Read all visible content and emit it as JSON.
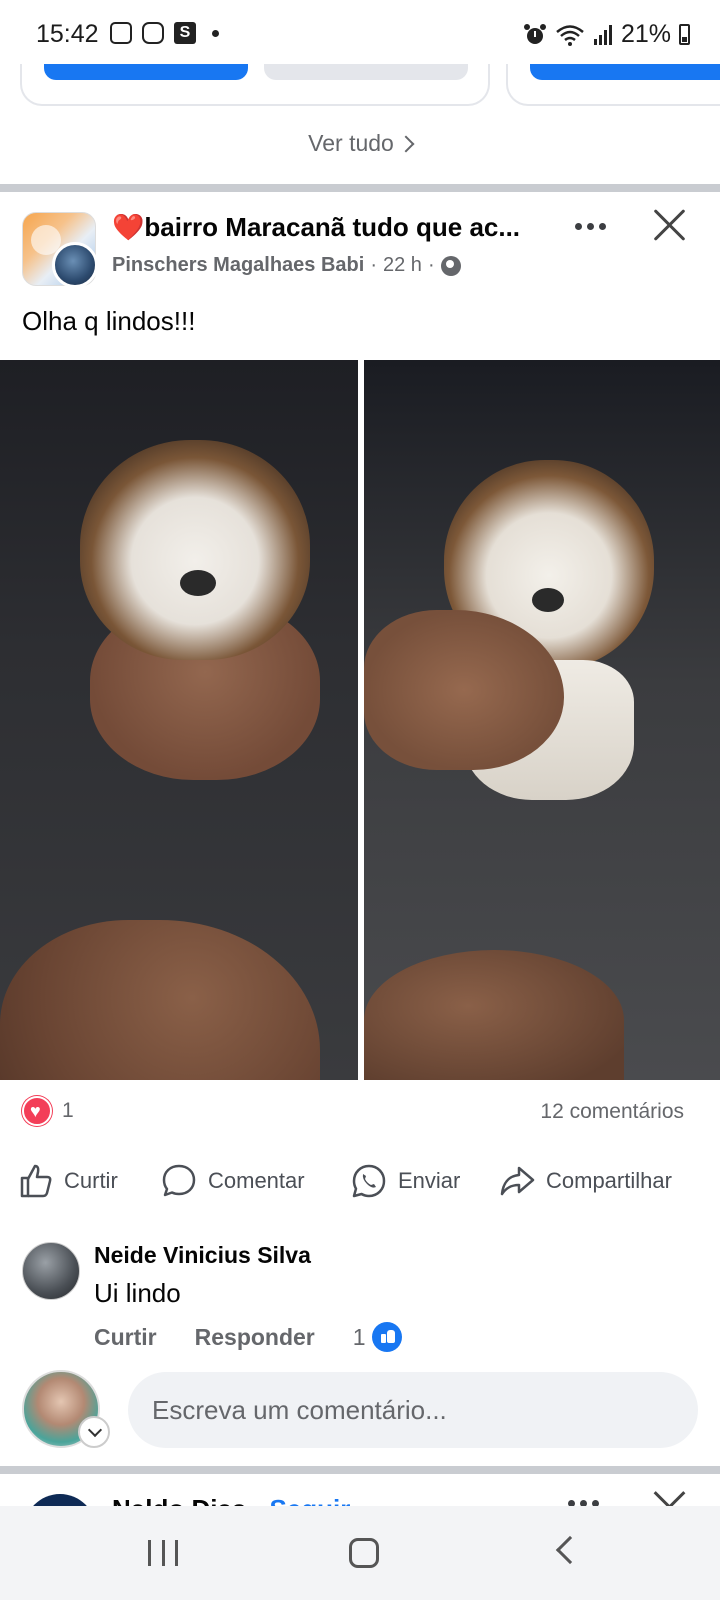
{
  "status_bar": {
    "time": "15:42",
    "battery": "21%",
    "icons_left": [
      "messenger-icon",
      "instagram-icon",
      "s-app-icon",
      "dot-icon"
    ],
    "icons_right": [
      "alarm-icon",
      "wifi-icon",
      "signal-icon",
      "battery-icon"
    ]
  },
  "previous_section": {
    "see_all_label": "Ver tudo",
    "colors": {
      "button_blue": "#1877f2",
      "button_gray": "#e4e6eb"
    }
  },
  "post": {
    "title_emoji": "❤️",
    "title": "bairro Maracanã tudo que ac...",
    "author": "Pinschers Magalhaes Babi",
    "time": "22 h",
    "separator": "·",
    "privacy_icon": "globe-icon",
    "text": "Olha q lindos!!!",
    "reaction_count": "1",
    "comments_count": "12 comentários",
    "actions": {
      "like": "Curtir",
      "comment": "Comentar",
      "send": "Enviar",
      "share": "Compartilhar"
    }
  },
  "comment": {
    "author": "Neide Vinicius Silva",
    "text": "Ui lindo",
    "like_label": "Curtir",
    "reply_label": "Responder",
    "like_count": "1"
  },
  "composer": {
    "placeholder": "Escreva um comentário..."
  },
  "next_post": {
    "author": "Naldo Dias",
    "separator": " · ",
    "follow_label": "Seguir"
  },
  "colors": {
    "accent": "#1877f2",
    "heart": "#f33e58",
    "secondary_text": "#65676b",
    "divider": "#c9ccd1"
  }
}
